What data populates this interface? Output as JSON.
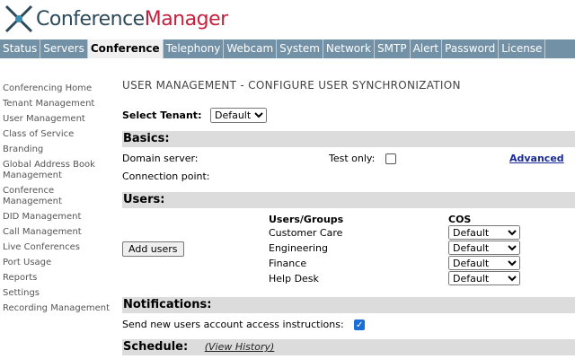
{
  "app": {
    "logo_part1": "Conference",
    "logo_part2": "Manager"
  },
  "nav": [
    "Status",
    "Servers",
    "Conference",
    "Telephony",
    "Webcam",
    "System",
    "Network",
    "SMTP",
    "Alert",
    "Password",
    "License"
  ],
  "sidebar": [
    "Conferencing Home",
    "Tenant Management",
    "User Management",
    "Class of Service",
    "Branding",
    "Global Address Book Management",
    "Conference Management",
    "DID Management",
    "Call Management",
    "Live Conferences",
    "Port Usage",
    "Reports",
    "Settings",
    "Recording Management"
  ],
  "page": {
    "title": "USER MANAGEMENT - CONFIGURE USER SYNCHRONIZATION",
    "tenant_label": "Select Tenant:",
    "tenant_value": "Default"
  },
  "basics": {
    "heading": "Basics:",
    "domain_server": "Domain server:",
    "connection_point": "Connection point:",
    "test_only": "Test only:",
    "advanced": "Advanced"
  },
  "users": {
    "heading": "Users:",
    "add_users": "Add users",
    "col_groups": "Users/Groups",
    "col_cos": "COS",
    "rows": [
      {
        "group": "Customer Care",
        "cos": "Default"
      },
      {
        "group": "Engineering",
        "cos": "Default"
      },
      {
        "group": "Finance",
        "cos": "Default"
      },
      {
        "group": "Help Desk",
        "cos": "Default"
      }
    ]
  },
  "notifications": {
    "heading": "Notifications:",
    "send_label": "Send new users account access instructions:",
    "checked": true
  },
  "schedule": {
    "heading": "Schedule:",
    "view_history": "(View History)"
  }
}
